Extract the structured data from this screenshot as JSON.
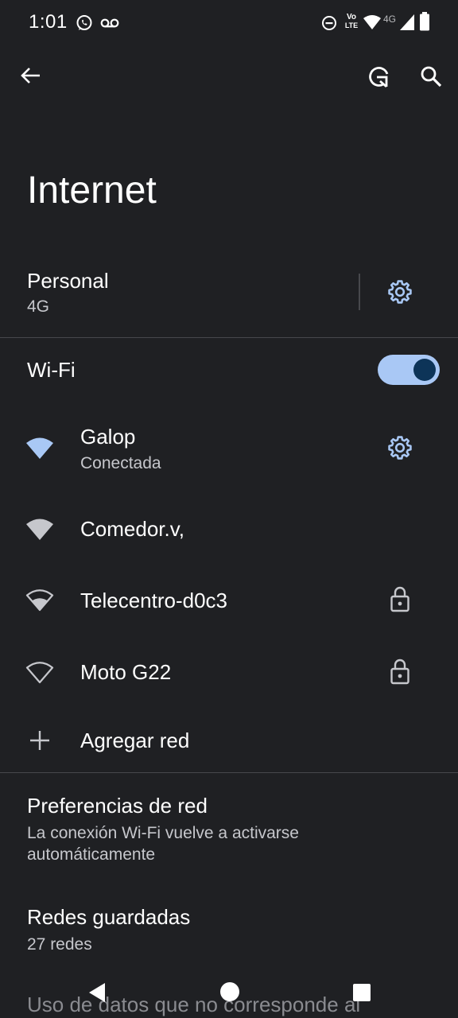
{
  "status_bar": {
    "time": "1:01",
    "icons": [
      "whatsapp-icon",
      "voicemail-icon",
      "dnd-icon",
      "volte-icon",
      "wifi-icon",
      "4g-icon",
      "signal-icon",
      "battery-icon"
    ],
    "volte_label_top": "Vo",
    "volte_label_bottom": "LTE",
    "network_label": "4G"
  },
  "app_bar": {
    "icons": [
      "back-arrow-icon",
      "refresh-icon",
      "search-icon"
    ]
  },
  "page": {
    "title": "Internet"
  },
  "mobile": {
    "name": "Personal",
    "type": "4G",
    "settings_icon": "gear-icon"
  },
  "wifi": {
    "label": "Wi-Fi",
    "enabled": true,
    "colors": {
      "toggle_track": "#a9c8f5",
      "toggle_knob": "#0d3458",
      "connected_icon": "#a9c8f5"
    },
    "networks": [
      {
        "name": "Galop",
        "status": "Conectada",
        "icon": "wifi-full-icon",
        "action": "gear-icon"
      },
      {
        "name": "Comedor.v,",
        "status": "",
        "icon": "wifi-full-icon",
        "action": ""
      },
      {
        "name": "Telecentro-d0c3",
        "status": "",
        "icon": "wifi-medium-icon",
        "action": "lock-icon"
      },
      {
        "name": "Moto G22",
        "status": "",
        "icon": "wifi-outline-icon",
        "action": "lock-icon"
      }
    ],
    "add_network": "Agregar red"
  },
  "preferences": {
    "title": "Preferencias de red",
    "subtitle_line1": "La conexión Wi-Fi vuelve a activarse",
    "subtitle_line2": "automáticamente"
  },
  "saved": {
    "title": "Redes guardadas",
    "subtitle": "27 redes"
  },
  "partial_text": "Uso de datos que no corresponde al",
  "nav_bar": {
    "icons": [
      "back-triangle-icon",
      "home-circle-icon",
      "recents-square-icon"
    ]
  }
}
